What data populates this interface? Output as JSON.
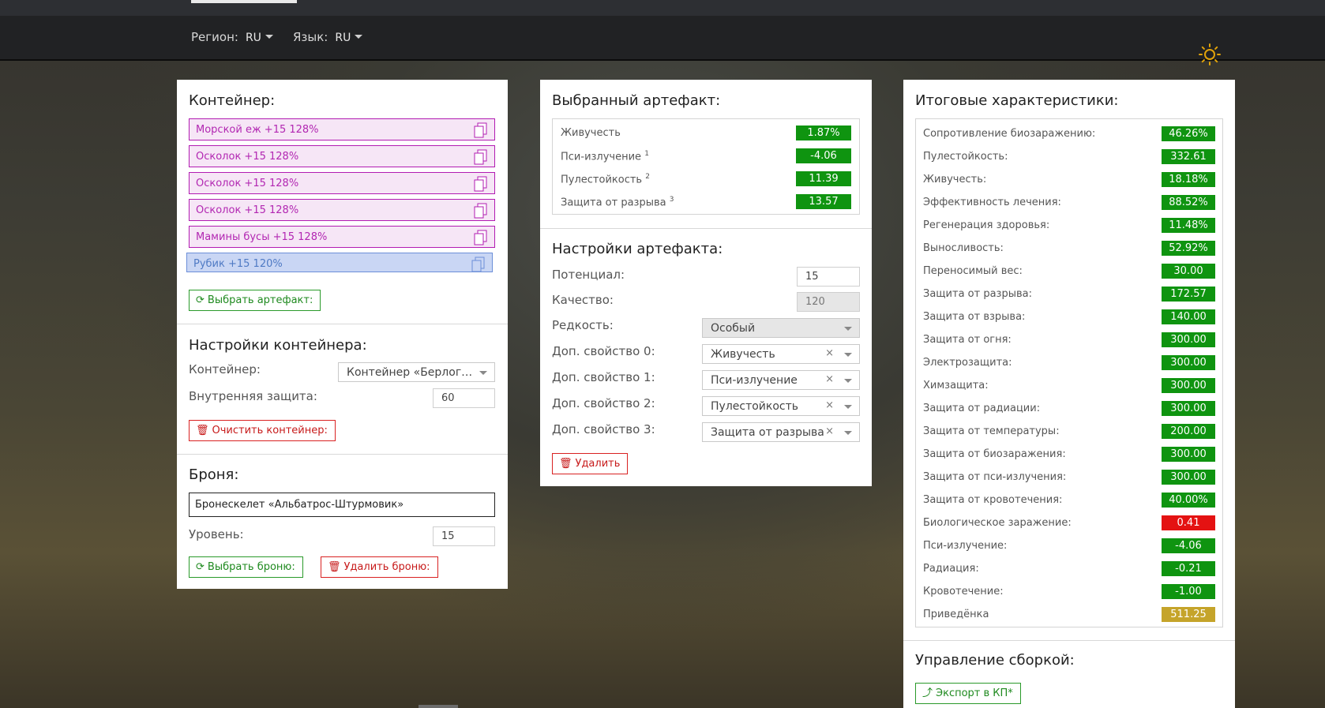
{
  "nav": {
    "region_label": "Регион:",
    "region_value": "RU",
    "lang_label": "Язык:",
    "lang_value": "RU"
  },
  "colors": {
    "positive": "#0f9410",
    "negative": "#e41212",
    "highlight": "#c5a42a",
    "legendary": "#b21cb2",
    "selected": "#6c8fd8"
  },
  "container": {
    "title": "Контейнер:",
    "artifacts": [
      "Морской еж +15 128%",
      "Осколок +15 128%",
      "Осколок +15 128%",
      "Осколок +15 128%",
      "Мамины бусы +15 128%",
      "Рубик +15 120%"
    ],
    "select_button": "Выбрать артефакт:",
    "settings_title": "Настройки контейнера:",
    "container_label": "Контейнер:",
    "container_value": "Контейнер «Берлога…",
    "inner_protection_label": "Внутренняя защита:",
    "inner_protection_value": "60",
    "clear_button": "Очистить контейнер:"
  },
  "armor": {
    "title": "Броня:",
    "name": "Бронескелет «Альбатрос-Штурмовик»",
    "level_label": "Уровень:",
    "level_value": "15",
    "select_button": "Выбрать броню:",
    "delete_button": "Удалить броню:"
  },
  "selected_artifact": {
    "title": "Выбранный артефакт:",
    "stats": [
      {
        "name": "Живучесть",
        "sup": "",
        "value": "1.87%"
      },
      {
        "name": "Пси-излучение",
        "sup": "1",
        "value": "-4.06"
      },
      {
        "name": "Пулестойкость",
        "sup": "2",
        "value": "11.39"
      },
      {
        "name": "Защита от разрыва",
        "sup": "3",
        "value": "13.57"
      }
    ]
  },
  "artifact_settings": {
    "title": "Настройки артефакта:",
    "potential_label": "Потенциал:",
    "potential_value": "15",
    "quality_label": "Качество:",
    "quality_value": "120",
    "rarity_label": "Редкость:",
    "rarity_value": "Особый",
    "extra0_label": "Доп. свойство 0:",
    "extra0_value": "Живучесть",
    "extra1_label": "Доп. свойство 1:",
    "extra1_value": "Пси-излучение",
    "extra2_label": "Доп. свойство 2:",
    "extra2_value": "Пулестойкость",
    "extra3_label": "Доп. свойство 3:",
    "extra3_value": "Защита от разрыва",
    "clear_symbol": "×",
    "delete_button": "Удалить"
  },
  "totals": {
    "title": "Итоговые характеристики:",
    "stats": [
      {
        "name": "Сопротивление биозаражению:",
        "value": "46.26%"
      },
      {
        "name": "Пулестойкость:",
        "value": "332.61"
      },
      {
        "name": "Живучесть:",
        "value": "18.18%"
      },
      {
        "name": "Эффективность лечения:",
        "value": "88.52%"
      },
      {
        "name": "Регенерация здоровья:",
        "value": "11.48%"
      },
      {
        "name": "Выносливость:",
        "value": "52.92%"
      },
      {
        "name": "Переносимый вес:",
        "value": "30.00"
      },
      {
        "name": "Защита от разрыва:",
        "value": "172.57"
      },
      {
        "name": "Защита от взрыва:",
        "value": "140.00"
      },
      {
        "name": "Защита от огня:",
        "value": "300.00"
      },
      {
        "name": "Электрозащита:",
        "value": "300.00"
      },
      {
        "name": "Химзащита:",
        "value": "300.00"
      },
      {
        "name": "Защита от радиации:",
        "value": "300.00"
      },
      {
        "name": "Защита от температуры:",
        "value": "200.00"
      },
      {
        "name": "Защита от биозаражения:",
        "value": "300.00"
      },
      {
        "name": "Защита от пси-излучения:",
        "value": "300.00"
      },
      {
        "name": "Защита от кровотечения:",
        "value": "40.00%"
      },
      {
        "name": "Биологическое заражение:",
        "value": "0.41",
        "status": "negative"
      },
      {
        "name": "Пси-излучение:",
        "value": "-4.06"
      },
      {
        "name": "Радиация:",
        "value": "-0.21"
      },
      {
        "name": "Кровотечение:",
        "value": "-1.00"
      },
      {
        "name": "Приведёнка",
        "value": "511.25",
        "status": "highlight"
      }
    ],
    "build_title": "Управление сборкой:",
    "export_button": "Экспорт в КП*"
  }
}
